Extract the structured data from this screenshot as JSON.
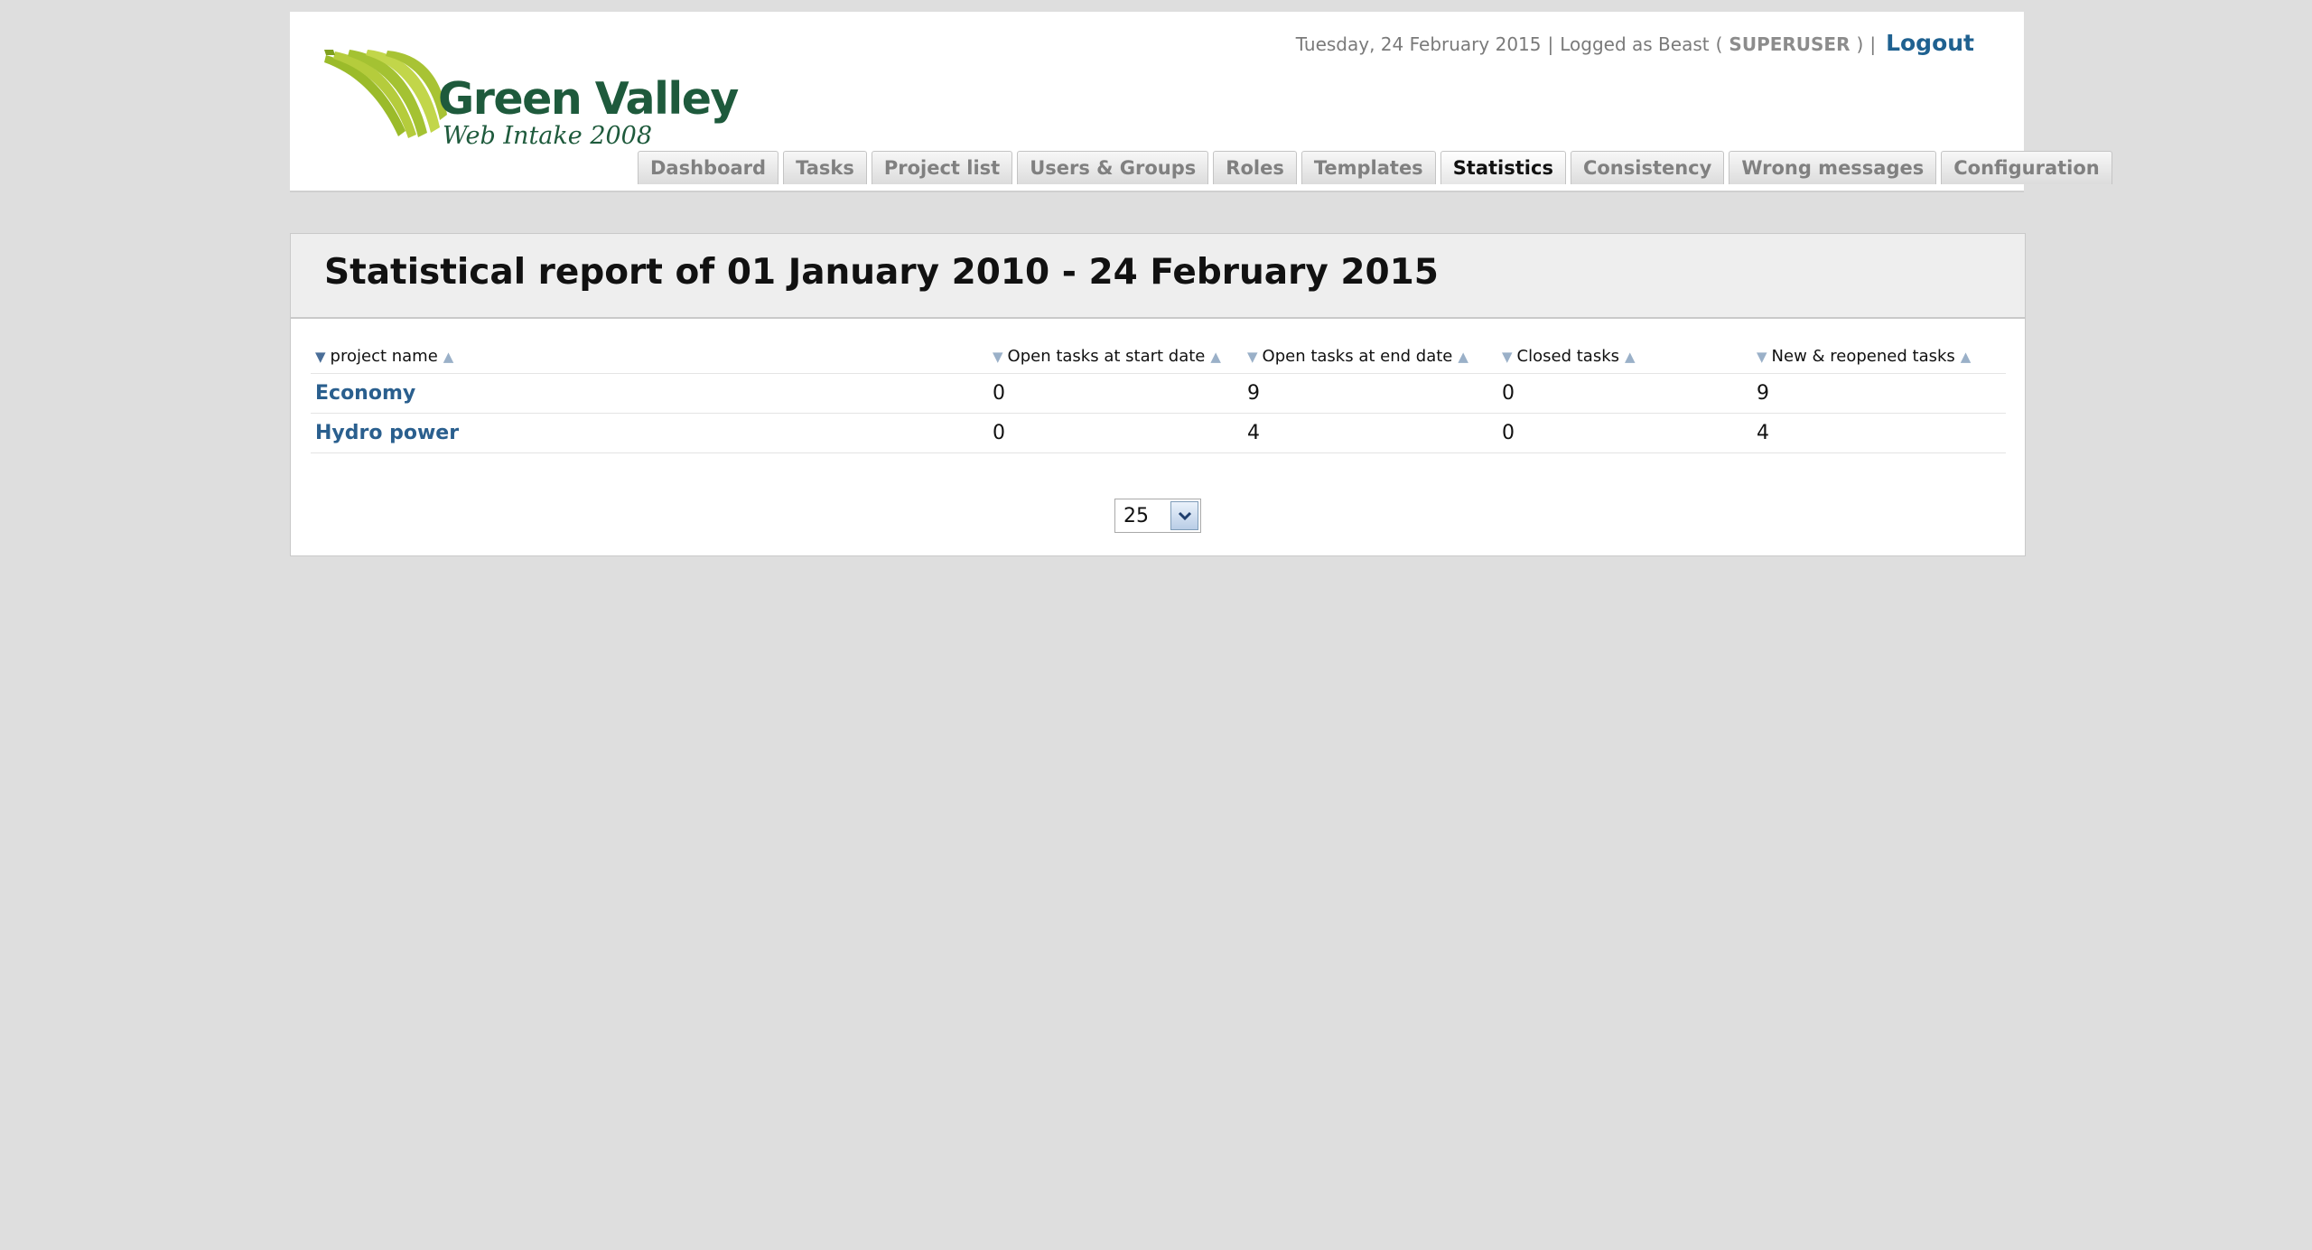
{
  "logo": {
    "title": "Green Valley",
    "subtitle": "Web Intake 2008"
  },
  "userbar": {
    "date": "Tuesday, 24 February 2015",
    "logged_as": "Logged as Beast",
    "role": "SUPERUSER",
    "logout_label": "Logout"
  },
  "tabs": [
    {
      "label": "Dashboard"
    },
    {
      "label": "Tasks"
    },
    {
      "label": "Project list"
    },
    {
      "label": "Users & Groups"
    },
    {
      "label": "Roles"
    },
    {
      "label": "Templates"
    },
    {
      "label": "Statistics",
      "active": true
    },
    {
      "label": "Consistency"
    },
    {
      "label": "Wrong messages"
    },
    {
      "label": "Configuration"
    }
  ],
  "report": {
    "title": "Statistical report of 01 January 2010 - 24 February 2015",
    "columns": [
      "project name",
      "Open tasks at start date",
      "Open tasks at end date",
      "Closed tasks",
      "New & reopened tasks"
    ],
    "rows": [
      {
        "project": "Economy",
        "open_start": "0",
        "open_end": "9",
        "closed": "0",
        "new_reopened": "9"
      },
      {
        "project": "Hydro power",
        "open_start": "0",
        "open_end": "4",
        "closed": "0",
        "new_reopened": "4"
      }
    ]
  },
  "pager": {
    "page_size": "25"
  },
  "colors": {
    "background": "#dedede",
    "brand_green": "#1e5a3c",
    "logo_lime": "#9bbb2a",
    "link_blue": "#2a5f8e"
  }
}
